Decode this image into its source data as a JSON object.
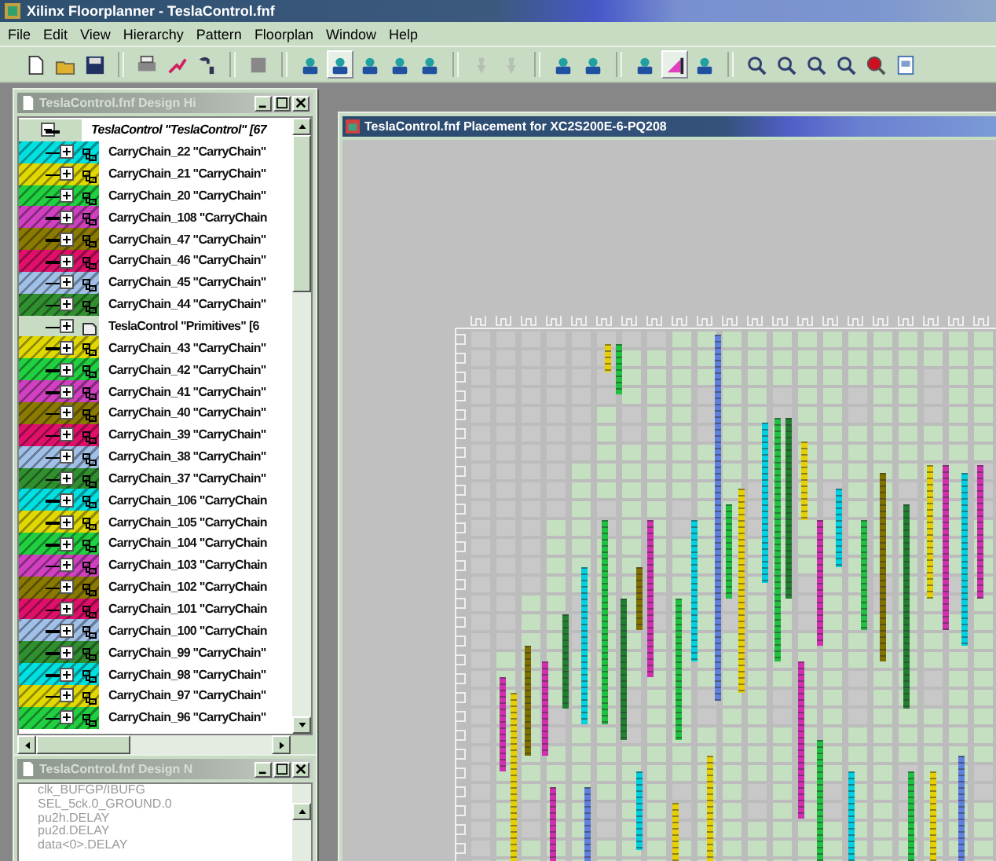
{
  "app": {
    "title": "Xilinx Floorplanner - TeslaControl.fnf"
  },
  "menu": [
    "File",
    "Edit",
    "View",
    "Hierarchy",
    "Pattern",
    "Floorplan",
    "Window",
    "Help"
  ],
  "toolbar": [
    {
      "selected": false,
      "disabled": false
    },
    {
      "selected": false,
      "disabled": false
    },
    {
      "selected": false,
      "disabled": false
    },
    {
      "selected": false,
      "disabled": false
    },
    {
      "selected": false,
      "disabled": false
    },
    {
      "selected": false,
      "disabled": false
    },
    {
      "selected": false,
      "disabled": false
    },
    {
      "selected": false,
      "disabled": false
    },
    {
      "selected": true,
      "disabled": false
    },
    {
      "selected": false,
      "disabled": false
    },
    {
      "selected": false,
      "disabled": false
    },
    {
      "selected": false,
      "disabled": false
    },
    {
      "selected": false,
      "disabled": true
    },
    {
      "selected": false,
      "disabled": true
    },
    {
      "selected": false,
      "disabled": false
    },
    {
      "selected": false,
      "disabled": false
    },
    {
      "selected": false,
      "disabled": false
    },
    {
      "selected": true,
      "disabled": false
    },
    {
      "selected": false,
      "disabled": false
    },
    {
      "selected": false,
      "disabled": false
    },
    {
      "selected": false,
      "disabled": false
    },
    {
      "selected": false,
      "disabled": false
    },
    {
      "selected": false,
      "disabled": false
    },
    {
      "selected": false,
      "disabled": false
    },
    {
      "selected": false,
      "disabled": false
    }
  ],
  "hierarchy": {
    "title": "TeslaControl.fnf Design Hi",
    "tree": {
      "label": "TeslaControl \"TeslaControl\" [67",
      "expanded": true,
      "children": [
        {
          "kind": "chain",
          "label": "CarryChain_22 \"CarryChain\"",
          "color": "#00e0e0",
          "expanded": false
        },
        {
          "kind": "chain",
          "label": "CarryChain_21 \"CarryChain\"",
          "color": "#e0d800",
          "expanded": false
        },
        {
          "kind": "chain",
          "label": "CarryChain_20 \"CarryChain\"",
          "color": "#20d040",
          "expanded": false
        },
        {
          "kind": "chain",
          "label": "CarryChain_108 \"CarryChain",
          "color": "#d040c0",
          "expanded": false
        },
        {
          "kind": "chain",
          "label": "CarryChain_47 \"CarryChain\"",
          "color": "#8a7a00",
          "expanded": false
        },
        {
          "kind": "chain",
          "label": "CarryChain_46 \"CarryChain\"",
          "color": "#e0106a",
          "expanded": false
        },
        {
          "kind": "chain",
          "label": "CarryChain_45 \"CarryChain\"",
          "color": "#a0c0e8",
          "expanded": false
        },
        {
          "kind": "chain",
          "label": "CarryChain_44 \"CarryChain\"",
          "color": "#309030",
          "expanded": false
        },
        {
          "kind": "group",
          "label": "TeslaControl \"Primitives\" [6",
          "expanded": false
        },
        {
          "kind": "chain",
          "label": "CarryChain_43 \"CarryChain\"",
          "color": "#e0d800",
          "expanded": false
        },
        {
          "kind": "chain",
          "label": "CarryChain_42 \"CarryChain\"",
          "color": "#20d040",
          "expanded": false
        },
        {
          "kind": "chain",
          "label": "CarryChain_41 \"CarryChain\"",
          "color": "#d040c0",
          "expanded": false
        },
        {
          "kind": "chain",
          "label": "CarryChain_40 \"CarryChain\"",
          "color": "#8a7a00",
          "expanded": false
        },
        {
          "kind": "chain",
          "label": "CarryChain_39 \"CarryChain\"",
          "color": "#e0106a",
          "expanded": false
        },
        {
          "kind": "chain",
          "label": "CarryChain_38 \"CarryChain\"",
          "color": "#a0c0e8",
          "expanded": false
        },
        {
          "kind": "chain",
          "label": "CarryChain_37 \"CarryChain\"",
          "color": "#309030",
          "expanded": false
        },
        {
          "kind": "chain",
          "label": "CarryChain_106 \"CarryChain",
          "color": "#00e0e0",
          "expanded": false
        },
        {
          "kind": "chain",
          "label": "CarryChain_105 \"CarryChain",
          "color": "#e0d800",
          "expanded": false
        },
        {
          "kind": "chain",
          "label": "CarryChain_104 \"CarryChain",
          "color": "#20d040",
          "expanded": false
        },
        {
          "kind": "chain",
          "label": "CarryChain_103 \"CarryChain",
          "color": "#d040c0",
          "expanded": false
        },
        {
          "kind": "chain",
          "label": "CarryChain_102 \"CarryChain",
          "color": "#8a7a00",
          "expanded": false
        },
        {
          "kind": "chain",
          "label": "CarryChain_101 \"CarryChain",
          "color": "#e0106a",
          "expanded": false
        },
        {
          "kind": "chain",
          "label": "CarryChain_100 \"CarryChain",
          "color": "#a0c0e8",
          "expanded": false
        },
        {
          "kind": "chain",
          "label": "CarryChain_99 \"CarryChain\"",
          "color": "#309030",
          "expanded": false
        },
        {
          "kind": "chain",
          "label": "CarryChain_98 \"CarryChain\"",
          "color": "#00e0e0",
          "expanded": false
        },
        {
          "kind": "chain",
          "label": "CarryChain_97 \"CarryChain\"",
          "color": "#e0d800",
          "expanded": false
        },
        {
          "kind": "chain",
          "label": "CarryChain_96 \"CarryChain\"",
          "color": "#20d040",
          "expanded": false
        }
      ]
    }
  },
  "nodes": {
    "title": "TeslaControl.fnf Design N",
    "items": [
      "clk_BUFGP/IBUFG",
      "SEL_5ck.0_GROUND.0",
      "pu2h.DELAY",
      "pu2d.DELAY",
      "data<0>.DELAY"
    ]
  },
  "placement": {
    "title": "TeslaControl.fnf Placement for XC2S200E-6-PQ208"
  }
}
